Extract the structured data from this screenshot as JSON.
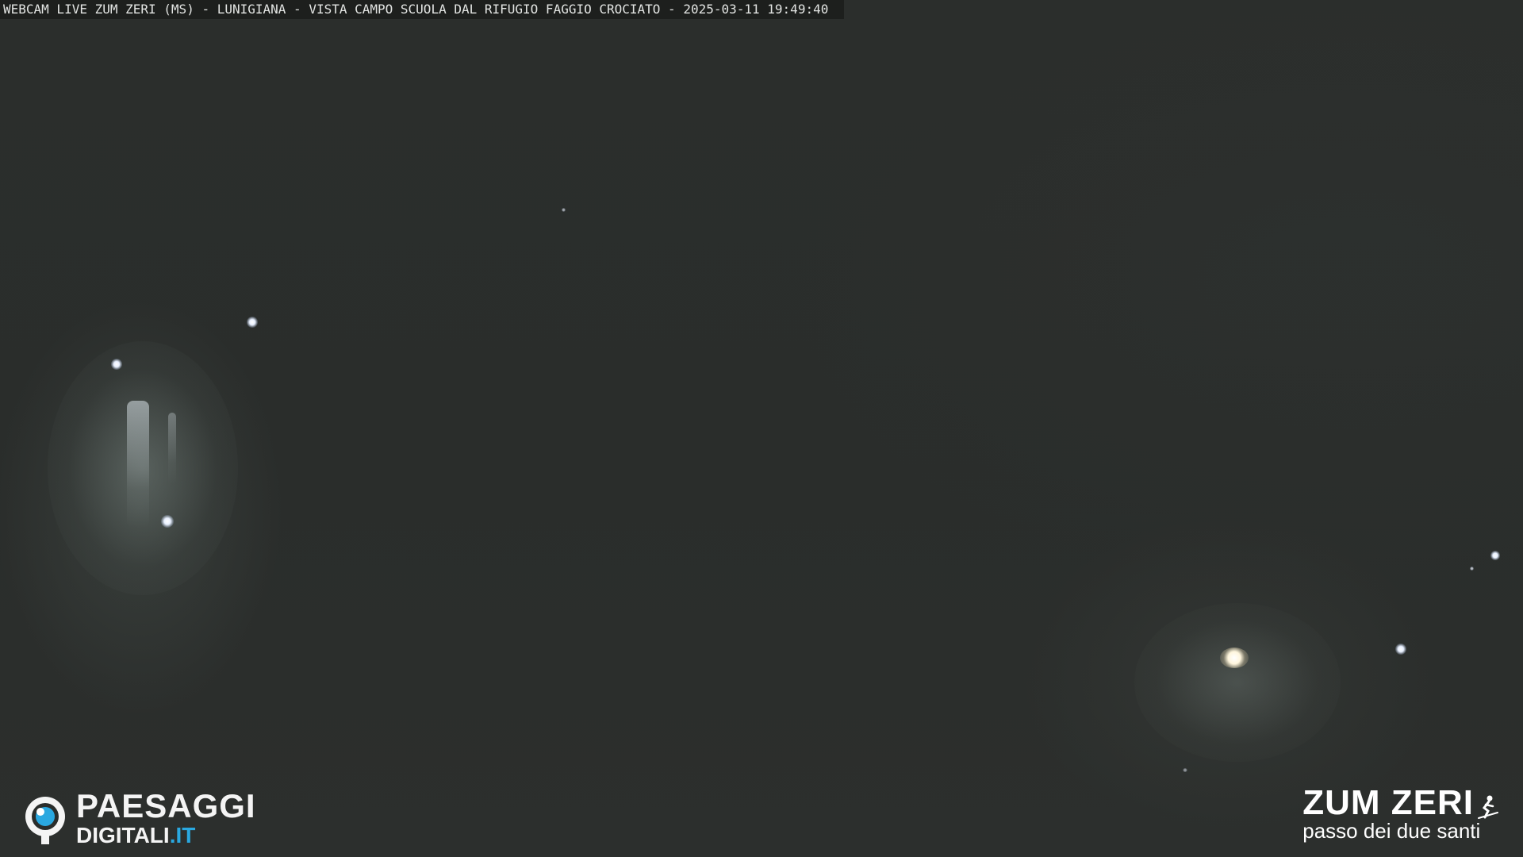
{
  "overlay": {
    "caption": "WEBCAM LIVE ZUM ZERI (MS) - LUNIGIANA - VISTA CAMPO SCUOLA DAL RIFUGIO FAGGIO CROCIATO - 2025-03-11 19:49:40"
  },
  "scene": {
    "icon": "night-webcam-view",
    "accent_sky": "#2a2d2b"
  },
  "logo_left": {
    "line1": "PAESAGGI",
    "line2_main": "DIGITALI",
    "line2_tld": ".IT",
    "icon": "eye-icon",
    "accent_color": "#2aa8e0"
  },
  "logo_right": {
    "title": "ZUM ZERI",
    "subtitle": "passo dei due santi",
    "icon": "skier-icon"
  }
}
